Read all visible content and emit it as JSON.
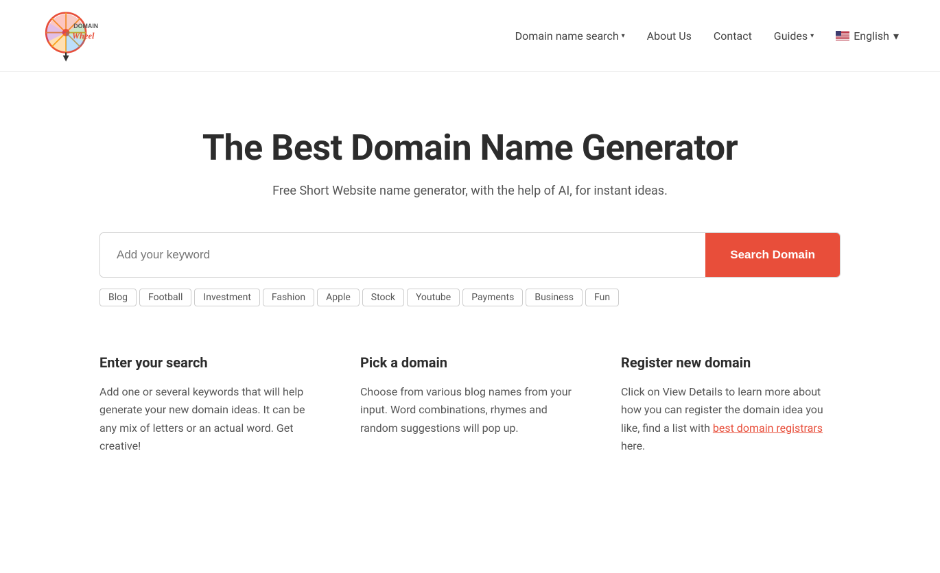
{
  "nav": {
    "logo_alt": "Domain Wheel",
    "links": [
      {
        "label": "Domain name search",
        "has_dropdown": true,
        "name": "nav-domain-search"
      },
      {
        "label": "About Us",
        "has_dropdown": false,
        "name": "nav-about-us"
      },
      {
        "label": "Contact",
        "has_dropdown": false,
        "name": "nav-contact"
      },
      {
        "label": "Guides",
        "has_dropdown": true,
        "name": "nav-guides"
      }
    ],
    "lang": {
      "label": "English",
      "has_dropdown": true
    }
  },
  "hero": {
    "title": "The Best Domain Name Generator",
    "subtitle": "Free Short Website name generator, with the help of AI, for instant ideas."
  },
  "search": {
    "placeholder": "Add your keyword",
    "button_label": "Search Domain"
  },
  "tags": [
    "Blog",
    "Football",
    "Investment",
    "Fashion",
    "Apple",
    "Stock",
    "Youtube",
    "Payments",
    "Business",
    "Fun"
  ],
  "features": [
    {
      "title": "Enter your search",
      "text": "Add one or several keywords that will help generate your new domain ideas. It can be any mix of letters or an actual word. Get creative!",
      "link": null,
      "link_text": null,
      "link_after": null
    },
    {
      "title": "Pick a domain",
      "text": "Choose from various blog names from your input. Word combinations, rhymes and random suggestions will pop up.",
      "link": null,
      "link_text": null,
      "link_after": null
    },
    {
      "title": "Register new domain",
      "text_before": "Click on View Details to learn more about how you can register the domain idea you like, find a list with ",
      "link_text": "best domain registrars",
      "text_after": " here.",
      "link_href": "#"
    }
  ],
  "colors": {
    "accent": "#e84e3a",
    "text_dark": "#2c2c2c",
    "text_muted": "#555"
  }
}
